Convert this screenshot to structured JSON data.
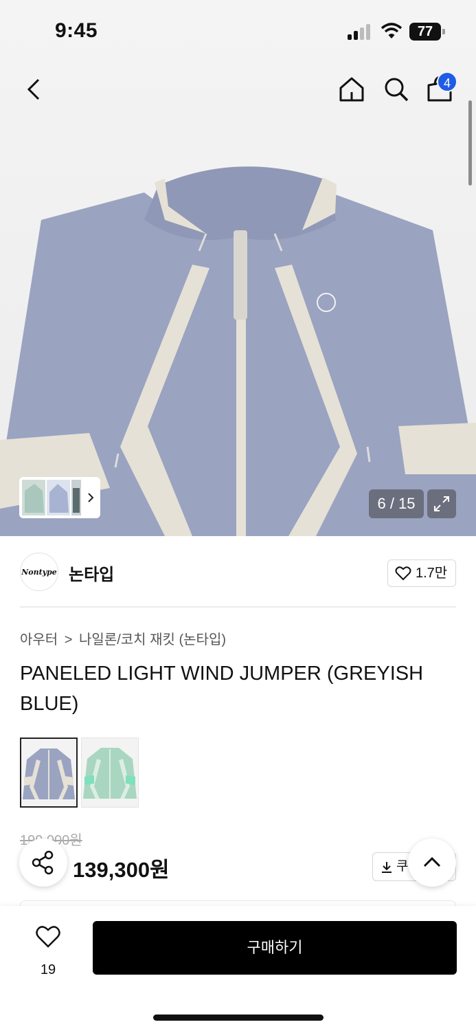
{
  "status_bar": {
    "time": "9:45",
    "battery": "77"
  },
  "nav": {
    "cart_count": "4"
  },
  "gallery": {
    "counter": "6 / 15"
  },
  "brand": {
    "logo_text": "Nontype",
    "name": "논타입",
    "likes": "1.7만"
  },
  "breadcrumb": {
    "category": "아우터",
    "separator": ">",
    "subcategory": "나일론/코치 재킷 (논타입)"
  },
  "product": {
    "title": "PANELED LIGHT WIND JUMPER (GREYISH BLUE)",
    "original_price": "199,000원",
    "price": "139,300원",
    "coupon_label": "쿠"
  },
  "bottom_bar": {
    "wish_count": "19",
    "buy_label": "구매하기"
  },
  "colors": {
    "jacket_blue": "#9aa3c0",
    "panel_cream": "#e6e1d6",
    "mint_jacket": "#a9d6c0",
    "badge_blue": "#1f5ce6"
  },
  "icons": [
    "back-icon",
    "home-icon",
    "search-icon",
    "cart-icon",
    "chevron-right-icon",
    "expand-icon",
    "heart-icon",
    "share-icon",
    "download-icon",
    "chevron-up-icon"
  ]
}
